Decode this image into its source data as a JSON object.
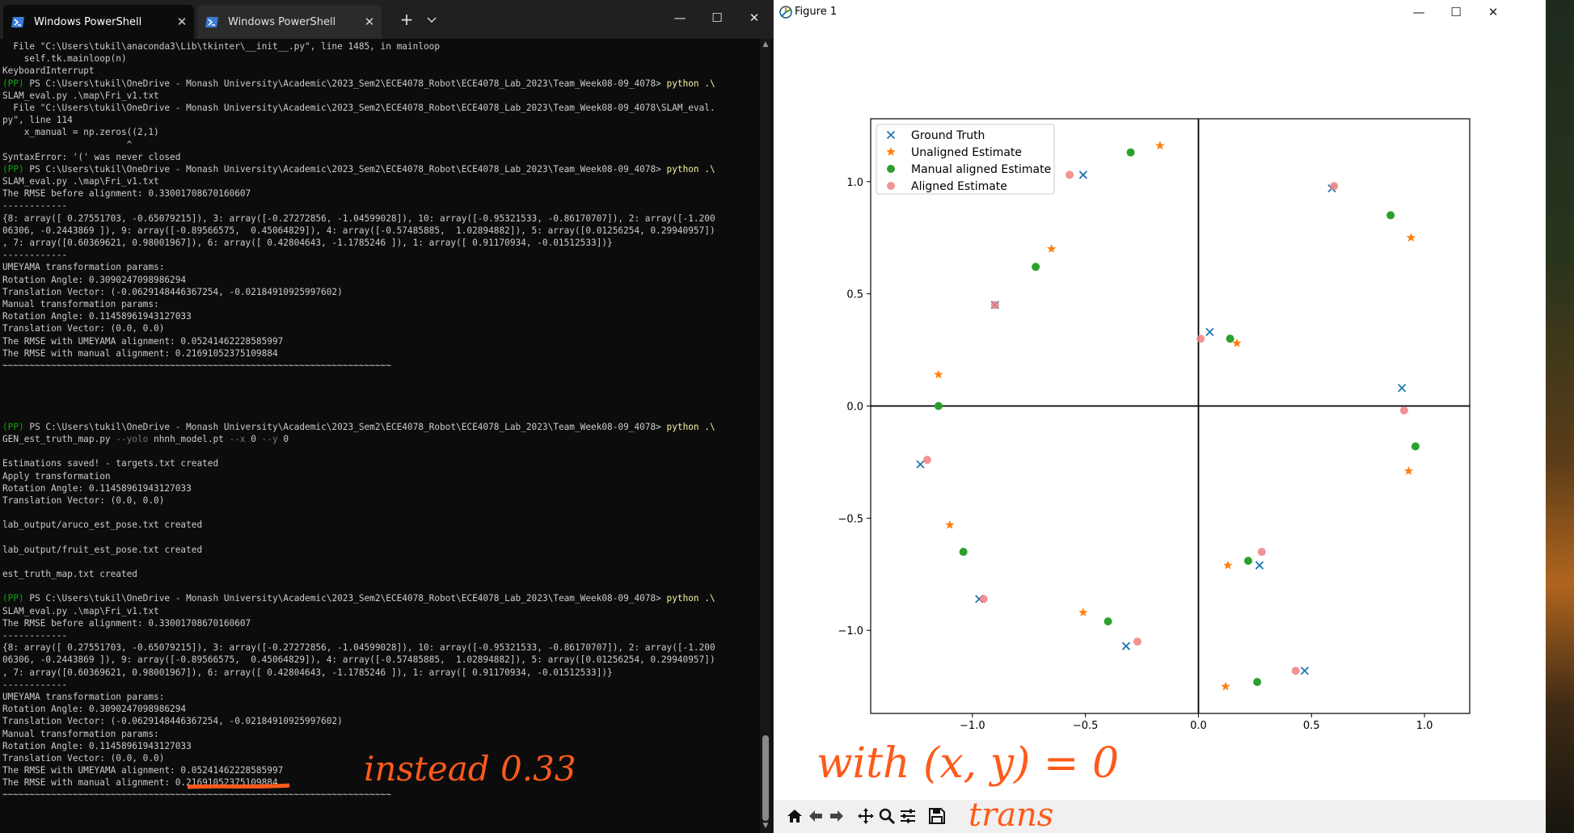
{
  "terminal": {
    "tabs": [
      {
        "title": "Windows PowerShell",
        "active": true
      },
      {
        "title": "Windows PowerShell",
        "active": false
      }
    ],
    "new_tab": "+",
    "dropdown": "⌄",
    "window_controls": {
      "minimize": "—",
      "maximize": "☐",
      "close": "✕"
    },
    "lines": [
      {
        "t": "plain",
        "s": "  File \"C:\\Users\\tukil\\anaconda3\\Lib\\tkinter\\__init__.py\", line 1485, in mainloop"
      },
      {
        "t": "plain",
        "s": "    self.tk.mainloop(n)"
      },
      {
        "t": "plain",
        "s": "KeyboardInterrupt"
      },
      {
        "t": "prompt",
        "pp": "(PP)",
        "path": " PS C:\\Users\\tukil\\OneDrive - Monash University\\Academic\\2023_Sem2\\ECE4078_Robot\\ECE4078_Lab_2023\\Team_Week08-09_4078> ",
        "cmd": "python .\\"
      },
      {
        "t": "plain",
        "s": "SLAM_eval.py .\\map\\Fri_v1.txt"
      },
      {
        "t": "plain",
        "s": "  File \"C:\\Users\\tukil\\OneDrive - Monash University\\Academic\\2023_Sem2\\ECE4078_Robot\\ECE4078_Lab_2023\\Team_Week08-09_4078\\SLAM_eval."
      },
      {
        "t": "plain",
        "s": "py\", line 114"
      },
      {
        "t": "plain",
        "s": "    x_manual = np.zeros((2,1)"
      },
      {
        "t": "plain",
        "s": "                       ^"
      },
      {
        "t": "plain",
        "s": "SyntaxError: '(' was never closed"
      },
      {
        "t": "prompt",
        "pp": "(PP)",
        "path": " PS C:\\Users\\tukil\\OneDrive - Monash University\\Academic\\2023_Sem2\\ECE4078_Robot\\ECE4078_Lab_2023\\Team_Week08-09_4078> ",
        "cmd": "python .\\"
      },
      {
        "t": "plain",
        "s": "SLAM_eval.py .\\map\\Fri_v1.txt"
      },
      {
        "t": "plain",
        "s": "The RMSE before alignment: 0.33001708670160607"
      },
      {
        "t": "plain",
        "s": "------------"
      },
      {
        "t": "plain",
        "s": "{8: array([ 0.27551703, -0.65079215]), 3: array([-0.27272856, -1.04599028]), 10: array([-0.95321533, -0.86170707]), 2: array([-1.200"
      },
      {
        "t": "plain",
        "s": "06306, -0.2443869 ]), 9: array([-0.89566575,  0.45064829]), 4: array([-0.57485885,  1.02894882]), 5: array([0.01256254, 0.29940957])"
      },
      {
        "t": "plain",
        "s": ", 7: array([0.60369621, 0.98001967]), 6: array([ 0.42804643, -1.1785246 ]), 1: array([ 0.91170934, -0.01512533])}"
      },
      {
        "t": "plain",
        "s": "------------"
      },
      {
        "t": "plain",
        "s": "UMEYAMA transformation params:"
      },
      {
        "t": "plain",
        "s": "Rotation Angle: 0.3090247098986294"
      },
      {
        "t": "plain",
        "s": "Translation Vector: (-0.0629148446367254, -0.02184910925997602)"
      },
      {
        "t": "plain",
        "s": "Manual transformation params:"
      },
      {
        "t": "plain",
        "s": "Rotation Angle: 0.11458961943127033"
      },
      {
        "t": "plain",
        "s": "Translation Vector: (0.0, 0.0)"
      },
      {
        "t": "plain",
        "s": "The RMSE with UMEYAMA alignment: 0.05241462228585997"
      },
      {
        "t": "plain",
        "s": "The RMSE with manual alignment: 0.21691052375109884"
      },
      {
        "t": "plain",
        "s": "~~~~~~~~~~~~~~~~~~~~~~~~~~~~~~~~~~~~~~~~~~~~~~~~~~~~~~~~~~~~~~~~~~~~~~~~"
      },
      {
        "t": "plain",
        "s": ""
      },
      {
        "t": "plain",
        "s": ""
      },
      {
        "t": "plain",
        "s": ""
      },
      {
        "t": "plain",
        "s": ""
      },
      {
        "t": "prompt",
        "pp": "(PP)",
        "path": " PS C:\\Users\\tukil\\OneDrive - Monash University\\Academic\\2023_Sem2\\ECE4078_Robot\\ECE4078_Lab_2023\\Team_Week08-09_4078> ",
        "cmd": "python .\\"
      },
      {
        "t": "gen",
        "a": "GEN_est_truth_map.py ",
        "b": "--yolo ",
        "c": "nhnh_model.pt ",
        "d": "--x ",
        "e": "0 ",
        "f": "--y ",
        "g": "0"
      },
      {
        "t": "plain",
        "s": ""
      },
      {
        "t": "plain",
        "s": "Estimations saved! - targets.txt created"
      },
      {
        "t": "plain",
        "s": "Apply transformation"
      },
      {
        "t": "plain",
        "s": "Rotation Angle: 0.11458961943127033"
      },
      {
        "t": "plain",
        "s": "Translation Vector: (0.0, 0.0)"
      },
      {
        "t": "plain",
        "s": ""
      },
      {
        "t": "plain",
        "s": "lab_output/aruco_est_pose.txt created"
      },
      {
        "t": "plain",
        "s": ""
      },
      {
        "t": "plain",
        "s": "lab_output/fruit_est_pose.txt created"
      },
      {
        "t": "plain",
        "s": ""
      },
      {
        "t": "plain",
        "s": "est_truth_map.txt created"
      },
      {
        "t": "plain",
        "s": ""
      },
      {
        "t": "prompt",
        "pp": "(PP)",
        "path": " PS C:\\Users\\tukil\\OneDrive - Monash University\\Academic\\2023_Sem2\\ECE4078_Robot\\ECE4078_Lab_2023\\Team_Week08-09_4078> ",
        "cmd": "python .\\"
      },
      {
        "t": "plain",
        "s": "SLAM_eval.py .\\map\\Fri_v1.txt"
      },
      {
        "t": "plain",
        "s": "The RMSE before alignment: 0.33001708670160607"
      },
      {
        "t": "plain",
        "s": "------------"
      },
      {
        "t": "plain",
        "s": "{8: array([ 0.27551703, -0.65079215]), 3: array([-0.27272856, -1.04599028]), 10: array([-0.95321533, -0.86170707]), 2: array([-1.200"
      },
      {
        "t": "plain",
        "s": "06306, -0.2443869 ]), 9: array([-0.89566575,  0.45064829]), 4: array([-0.57485885,  1.02894882]), 5: array([0.01256254, 0.29940957])"
      },
      {
        "t": "plain",
        "s": ", 7: array([0.60369621, 0.98001967]), 6: array([ 0.42804643, -1.1785246 ]), 1: array([ 0.91170934, -0.01512533])}"
      },
      {
        "t": "plain",
        "s": "------------"
      },
      {
        "t": "plain",
        "s": "UMEYAMA transformation params:"
      },
      {
        "t": "plain",
        "s": "Rotation Angle: 0.3090247098986294"
      },
      {
        "t": "plain",
        "s": "Translation Vector: (-0.0629148446367254, -0.02184910925997602)"
      },
      {
        "t": "plain",
        "s": "Manual transformation params:"
      },
      {
        "t": "plain",
        "s": "Rotation Angle: 0.11458961943127033"
      },
      {
        "t": "plain",
        "s": "Translation Vector: (0.0, 0.0)"
      },
      {
        "t": "plain",
        "s": "The RMSE with UMEYAMA alignment: 0.05241462228585997"
      },
      {
        "t": "plain",
        "s": "The RMSE with manual alignment: 0.21691052375109884"
      },
      {
        "t": "plain",
        "s": "~~~~~~~~~~~~~~~~~~~~~~~~~~~~~~~~~~~~~~~~~~~~~~~~~~~~~~~~~~~~~~~~~~~~~~~~"
      }
    ]
  },
  "figure": {
    "title": "Figure 1",
    "window_controls": {
      "minimize": "—",
      "maximize": "☐",
      "close": "✕"
    },
    "toolbar_icons": [
      "home-icon",
      "back-icon",
      "forward-icon",
      "pan-icon",
      "zoom-icon",
      "configure-subplots-icon",
      "save-icon"
    ]
  },
  "annotations": {
    "note_right": "instead 0.33",
    "note_figure": "with (x, y) = 0",
    "note_trans": "trans"
  },
  "colors": {
    "ground_truth": "#1f77b4",
    "unaligned": "#ff7f0e",
    "manual": "#2ca02c",
    "aligned": "#f08080",
    "handwriting": "#ff5a1a"
  },
  "chart_data": {
    "type": "scatter",
    "xlim": [
      -1.45,
      1.2
    ],
    "ylim": [
      -1.37,
      1.28
    ],
    "xticks": [
      -1.0,
      -0.5,
      0.0,
      0.5,
      1.0
    ],
    "yticks": [
      -1.0,
      -0.5,
      0.0,
      0.5,
      1.0
    ],
    "tick_labels_x": [
      "−1.0",
      "−0.5",
      "0.0",
      "0.5",
      "1.0"
    ],
    "tick_labels_y": [
      "−1.0",
      "−0.5",
      "0.0",
      "0.5",
      "1.0"
    ],
    "axis_lines": {
      "x": 0.0,
      "y": 0.0
    },
    "grid": false,
    "legend_position": "upper left",
    "series": [
      {
        "name": "Ground Truth",
        "marker": "x",
        "color": "#1f77b4",
        "points": [
          [
            -0.51,
            1.03
          ],
          [
            0.59,
            0.97
          ],
          [
            -0.9,
            0.45
          ],
          [
            0.05,
            0.33
          ],
          [
            0.9,
            0.08
          ],
          [
            -1.23,
            -0.26
          ],
          [
            0.27,
            -0.71
          ],
          [
            -0.97,
            -0.86
          ],
          [
            -0.32,
            -1.07
          ],
          [
            0.47,
            -1.18
          ]
        ]
      },
      {
        "name": "Unaligned Estimate",
        "marker": "star",
        "color": "#ff7f0e",
        "points": [
          [
            -0.17,
            1.16
          ],
          [
            0.94,
            0.75
          ],
          [
            -0.65,
            0.7
          ],
          [
            0.17,
            0.28
          ],
          [
            -1.15,
            0.14
          ],
          [
            0.93,
            -0.29
          ],
          [
            -1.1,
            -0.53
          ],
          [
            0.13,
            -0.71
          ],
          [
            -0.51,
            -0.92
          ],
          [
            0.12,
            -1.25
          ]
        ]
      },
      {
        "name": "Manual aligned Estimate",
        "marker": "circle",
        "color": "#2ca02c",
        "points": [
          [
            -0.3,
            1.13
          ],
          [
            0.85,
            0.85
          ],
          [
            -0.72,
            0.62
          ],
          [
            0.14,
            0.3
          ],
          [
            -1.15,
            0.0
          ],
          [
            0.96,
            -0.18
          ],
          [
            -1.04,
            -0.65
          ],
          [
            0.22,
            -0.69
          ],
          [
            -0.4,
            -0.96
          ],
          [
            0.26,
            -1.23
          ]
        ]
      },
      {
        "name": "Aligned Estimate",
        "marker": "circle",
        "color": "#f08080",
        "points": [
          [
            -0.57,
            1.03
          ],
          [
            0.6,
            0.98
          ],
          [
            -0.9,
            0.45
          ],
          [
            0.01,
            0.3
          ],
          [
            0.91,
            -0.02
          ],
          [
            -1.2,
            -0.24
          ],
          [
            0.28,
            -0.65
          ],
          [
            -0.95,
            -0.86
          ],
          [
            -0.27,
            -1.05
          ],
          [
            0.43,
            -1.18
          ]
        ]
      }
    ]
  }
}
